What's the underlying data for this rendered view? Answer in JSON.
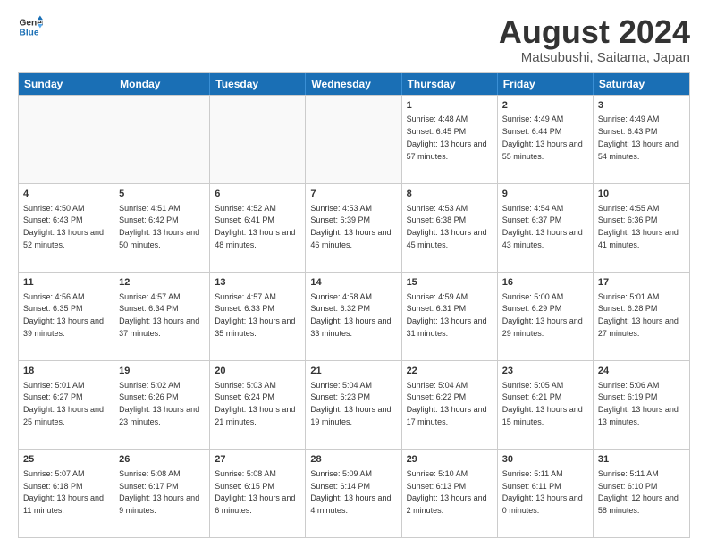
{
  "header": {
    "logo_line1": "General",
    "logo_line2": "Blue",
    "month_year": "August 2024",
    "location": "Matsubushi, Saitama, Japan"
  },
  "weekdays": [
    "Sunday",
    "Monday",
    "Tuesday",
    "Wednesday",
    "Thursday",
    "Friday",
    "Saturday"
  ],
  "rows": [
    [
      {
        "day": "",
        "sunrise": "",
        "sunset": "",
        "daylight": ""
      },
      {
        "day": "",
        "sunrise": "",
        "sunset": "",
        "daylight": ""
      },
      {
        "day": "",
        "sunrise": "",
        "sunset": "",
        "daylight": ""
      },
      {
        "day": "",
        "sunrise": "",
        "sunset": "",
        "daylight": ""
      },
      {
        "day": "1",
        "sunrise": "Sunrise: 4:48 AM",
        "sunset": "Sunset: 6:45 PM",
        "daylight": "Daylight: 13 hours and 57 minutes."
      },
      {
        "day": "2",
        "sunrise": "Sunrise: 4:49 AM",
        "sunset": "Sunset: 6:44 PM",
        "daylight": "Daylight: 13 hours and 55 minutes."
      },
      {
        "day": "3",
        "sunrise": "Sunrise: 4:49 AM",
        "sunset": "Sunset: 6:43 PM",
        "daylight": "Daylight: 13 hours and 54 minutes."
      }
    ],
    [
      {
        "day": "4",
        "sunrise": "Sunrise: 4:50 AM",
        "sunset": "Sunset: 6:43 PM",
        "daylight": "Daylight: 13 hours and 52 minutes."
      },
      {
        "day": "5",
        "sunrise": "Sunrise: 4:51 AM",
        "sunset": "Sunset: 6:42 PM",
        "daylight": "Daylight: 13 hours and 50 minutes."
      },
      {
        "day": "6",
        "sunrise": "Sunrise: 4:52 AM",
        "sunset": "Sunset: 6:41 PM",
        "daylight": "Daylight: 13 hours and 48 minutes."
      },
      {
        "day": "7",
        "sunrise": "Sunrise: 4:53 AM",
        "sunset": "Sunset: 6:39 PM",
        "daylight": "Daylight: 13 hours and 46 minutes."
      },
      {
        "day": "8",
        "sunrise": "Sunrise: 4:53 AM",
        "sunset": "Sunset: 6:38 PM",
        "daylight": "Daylight: 13 hours and 45 minutes."
      },
      {
        "day": "9",
        "sunrise": "Sunrise: 4:54 AM",
        "sunset": "Sunset: 6:37 PM",
        "daylight": "Daylight: 13 hours and 43 minutes."
      },
      {
        "day": "10",
        "sunrise": "Sunrise: 4:55 AM",
        "sunset": "Sunset: 6:36 PM",
        "daylight": "Daylight: 13 hours and 41 minutes."
      }
    ],
    [
      {
        "day": "11",
        "sunrise": "Sunrise: 4:56 AM",
        "sunset": "Sunset: 6:35 PM",
        "daylight": "Daylight: 13 hours and 39 minutes."
      },
      {
        "day": "12",
        "sunrise": "Sunrise: 4:57 AM",
        "sunset": "Sunset: 6:34 PM",
        "daylight": "Daylight: 13 hours and 37 minutes."
      },
      {
        "day": "13",
        "sunrise": "Sunrise: 4:57 AM",
        "sunset": "Sunset: 6:33 PM",
        "daylight": "Daylight: 13 hours and 35 minutes."
      },
      {
        "day": "14",
        "sunrise": "Sunrise: 4:58 AM",
        "sunset": "Sunset: 6:32 PM",
        "daylight": "Daylight: 13 hours and 33 minutes."
      },
      {
        "day": "15",
        "sunrise": "Sunrise: 4:59 AM",
        "sunset": "Sunset: 6:31 PM",
        "daylight": "Daylight: 13 hours and 31 minutes."
      },
      {
        "day": "16",
        "sunrise": "Sunrise: 5:00 AM",
        "sunset": "Sunset: 6:29 PM",
        "daylight": "Daylight: 13 hours and 29 minutes."
      },
      {
        "day": "17",
        "sunrise": "Sunrise: 5:01 AM",
        "sunset": "Sunset: 6:28 PM",
        "daylight": "Daylight: 13 hours and 27 minutes."
      }
    ],
    [
      {
        "day": "18",
        "sunrise": "Sunrise: 5:01 AM",
        "sunset": "Sunset: 6:27 PM",
        "daylight": "Daylight: 13 hours and 25 minutes."
      },
      {
        "day": "19",
        "sunrise": "Sunrise: 5:02 AM",
        "sunset": "Sunset: 6:26 PM",
        "daylight": "Daylight: 13 hours and 23 minutes."
      },
      {
        "day": "20",
        "sunrise": "Sunrise: 5:03 AM",
        "sunset": "Sunset: 6:24 PM",
        "daylight": "Daylight: 13 hours and 21 minutes."
      },
      {
        "day": "21",
        "sunrise": "Sunrise: 5:04 AM",
        "sunset": "Sunset: 6:23 PM",
        "daylight": "Daylight: 13 hours and 19 minutes."
      },
      {
        "day": "22",
        "sunrise": "Sunrise: 5:04 AM",
        "sunset": "Sunset: 6:22 PM",
        "daylight": "Daylight: 13 hours and 17 minutes."
      },
      {
        "day": "23",
        "sunrise": "Sunrise: 5:05 AM",
        "sunset": "Sunset: 6:21 PM",
        "daylight": "Daylight: 13 hours and 15 minutes."
      },
      {
        "day": "24",
        "sunrise": "Sunrise: 5:06 AM",
        "sunset": "Sunset: 6:19 PM",
        "daylight": "Daylight: 13 hours and 13 minutes."
      }
    ],
    [
      {
        "day": "25",
        "sunrise": "Sunrise: 5:07 AM",
        "sunset": "Sunset: 6:18 PM",
        "daylight": "Daylight: 13 hours and 11 minutes."
      },
      {
        "day": "26",
        "sunrise": "Sunrise: 5:08 AM",
        "sunset": "Sunset: 6:17 PM",
        "daylight": "Daylight: 13 hours and 9 minutes."
      },
      {
        "day": "27",
        "sunrise": "Sunrise: 5:08 AM",
        "sunset": "Sunset: 6:15 PM",
        "daylight": "Daylight: 13 hours and 6 minutes."
      },
      {
        "day": "28",
        "sunrise": "Sunrise: 5:09 AM",
        "sunset": "Sunset: 6:14 PM",
        "daylight": "Daylight: 13 hours and 4 minutes."
      },
      {
        "day": "29",
        "sunrise": "Sunrise: 5:10 AM",
        "sunset": "Sunset: 6:13 PM",
        "daylight": "Daylight: 13 hours and 2 minutes."
      },
      {
        "day": "30",
        "sunrise": "Sunrise: 5:11 AM",
        "sunset": "Sunset: 6:11 PM",
        "daylight": "Daylight: 13 hours and 0 minutes."
      },
      {
        "day": "31",
        "sunrise": "Sunrise: 5:11 AM",
        "sunset": "Sunset: 6:10 PM",
        "daylight": "Daylight: 12 hours and 58 minutes."
      }
    ]
  ]
}
